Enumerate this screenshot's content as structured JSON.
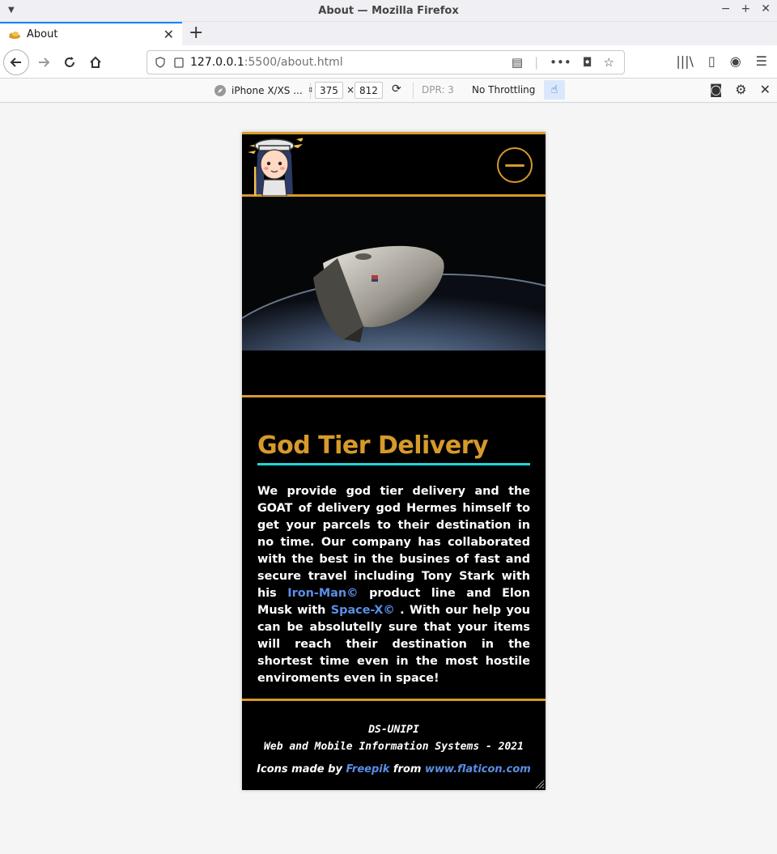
{
  "browser": {
    "window_title": "About — Mozilla Firefox",
    "tab_title": "About",
    "url_host": "127.0.0.1",
    "url_rest": ":5500/about.html",
    "new_tab_symbol": "+"
  },
  "rdm": {
    "device": "iPhone X/XS ...",
    "width": "375",
    "times": "×",
    "height": "812",
    "dpr": "DPR: 3",
    "throttling": "No Throttling"
  },
  "site": {
    "about_title": "God Tier Delivery",
    "about_text_1": "We provide god tier delivery and the GOAT of delivery god Hermes himself to get your parcels to their destination in no time. Our company has collaborated with the best in the busines of fast and secure travel including Tony Stark with his ",
    "link_ironman": "Iron-Man©",
    "about_text_2": " product line and Elon Musk with ",
    "link_spacex": "Space-X©",
    "about_text_3": " . With our help you can be absolutelly sure that your items will reach their destination in the shortest time even in the most hostile enviroments even in space!",
    "footer_line1": "DS-UNIPI",
    "footer_line2": "Web and Mobile Information Systems - 2021",
    "credits_prefix": "Icons made by ",
    "credits_author": "Freepik",
    "credits_mid": " from ",
    "credits_site": "www.flaticon.com"
  },
  "colors": {
    "accent_gold": "#d79a2a",
    "underline_cyan": "#1fd6d8",
    "link_blue": "#5b8ee6",
    "firefox_blue": "#0a84ff"
  },
  "icons": [
    "back-arrow-icon",
    "forward-arrow-icon",
    "reload-icon",
    "home-icon",
    "shield-icon",
    "lock-icon",
    "reader-view-icon",
    "more-icon",
    "pocket-icon",
    "bookmark-star-icon",
    "library-icon",
    "sidebar-icon",
    "account-icon",
    "menu-icon",
    "rotate-icon",
    "touch-icon",
    "screenshot-icon",
    "settings-icon",
    "close-icon",
    "hamburger-icon"
  ]
}
